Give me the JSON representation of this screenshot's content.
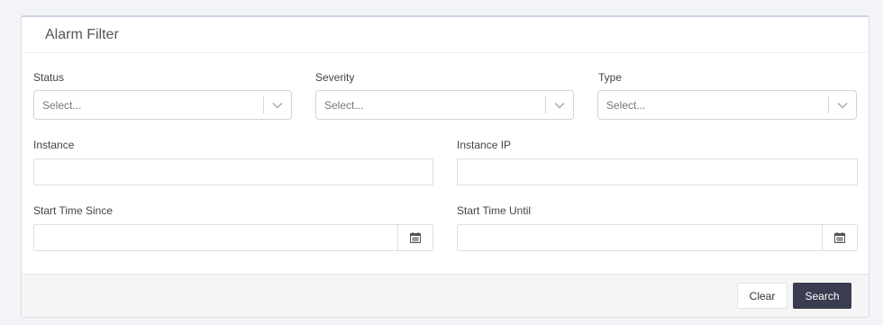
{
  "panel": {
    "title": "Alarm Filter"
  },
  "filters": {
    "status": {
      "label": "Status",
      "placeholder": "Select..."
    },
    "severity": {
      "label": "Severity",
      "placeholder": "Select..."
    },
    "type": {
      "label": "Type",
      "placeholder": "Select..."
    },
    "instance": {
      "label": "Instance",
      "value": ""
    },
    "instance_ip": {
      "label": "Instance IP",
      "value": ""
    },
    "start_time_since": {
      "label": "Start Time Since",
      "value": ""
    },
    "start_time_until": {
      "label": "Start Time Until",
      "value": ""
    }
  },
  "footer": {
    "clear_label": "Clear",
    "search_label": "Search"
  },
  "icons": {
    "select_arrow": "chevron-down-icon",
    "date_picker": "calendar-icon"
  },
  "colors": {
    "primary_button": "#393d4f",
    "page_background": "#f3f4f7"
  }
}
